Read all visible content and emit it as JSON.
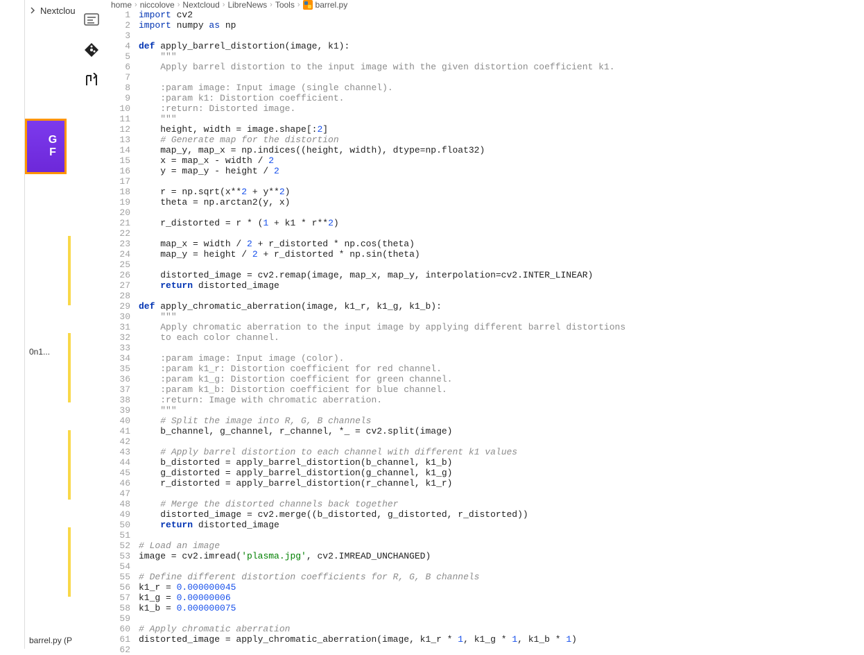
{
  "project": {
    "root_label": "Nextclou",
    "file_item": "0n1...",
    "thumb_line1": "G",
    "thumb_line2": "F"
  },
  "bottom_tab": "barrel.py (P",
  "breadcrumb": {
    "home": "home",
    "user": "niccolove",
    "cloud": "Nextcloud",
    "proj": "LibreNews",
    "dir": "Tools",
    "file": "barrel.py"
  },
  "code": {
    "total_lines": 62,
    "lines": [
      [
        [
          "imp",
          "import"
        ],
        [
          "",
          " cv2"
        ]
      ],
      [
        [
          "imp",
          "import"
        ],
        [
          "",
          " numpy "
        ],
        [
          "imp",
          "as"
        ],
        [
          "",
          " np"
        ]
      ],
      [
        [
          "",
          ""
        ]
      ],
      [
        [
          "kw",
          "def"
        ],
        [
          "",
          " apply_barrel_distortion(image, k1):"
        ]
      ],
      [
        [
          "",
          "    "
        ],
        [
          "doc",
          "\"\"\""
        ]
      ],
      [
        [
          "",
          "    "
        ],
        [
          "doc",
          "Apply barrel distortion to the input image with the given distortion coefficient k1."
        ]
      ],
      [
        [
          "",
          ""
        ]
      ],
      [
        [
          "",
          "    "
        ],
        [
          "doc",
          ":param image: Input image (single channel)."
        ]
      ],
      [
        [
          "",
          "    "
        ],
        [
          "doc",
          ":param k1: Distortion coefficient."
        ]
      ],
      [
        [
          "",
          "    "
        ],
        [
          "doc",
          ":return: Distorted image."
        ]
      ],
      [
        [
          "",
          "    "
        ],
        [
          "doc",
          "\"\"\""
        ]
      ],
      [
        [
          "",
          "    height, width = image.shape[:"
        ],
        [
          "num",
          "2"
        ],
        [
          "",
          "]"
        ]
      ],
      [
        [
          "",
          "    "
        ],
        [
          "cmt",
          "# Generate map for the distortion"
        ]
      ],
      [
        [
          "",
          "    map_y, map_x = np.indices((height, width), dtype=np.float32)"
        ]
      ],
      [
        [
          "",
          "    x = map_x - width / "
        ],
        [
          "num",
          "2"
        ]
      ],
      [
        [
          "",
          "    y = map_y - height / "
        ],
        [
          "num",
          "2"
        ]
      ],
      [
        [
          "",
          ""
        ]
      ],
      [
        [
          "",
          "    r = np.sqrt(x**"
        ],
        [
          "num",
          "2"
        ],
        [
          "",
          " + y**"
        ],
        [
          "num",
          "2"
        ],
        [
          "",
          ")"
        ]
      ],
      [
        [
          "",
          "    theta = np.arctan2(y, x)"
        ]
      ],
      [
        [
          "",
          ""
        ]
      ],
      [
        [
          "",
          "    r_distorted = r * ("
        ],
        [
          "num",
          "1"
        ],
        [
          "",
          " + k1 * r**"
        ],
        [
          "num",
          "2"
        ],
        [
          "",
          ")"
        ]
      ],
      [
        [
          "",
          ""
        ]
      ],
      [
        [
          "",
          "    map_x = width / "
        ],
        [
          "num",
          "2"
        ],
        [
          "",
          " + r_distorted * np.cos(theta)"
        ]
      ],
      [
        [
          "",
          "    map_y = height / "
        ],
        [
          "num",
          "2"
        ],
        [
          "",
          " + r_distorted * np.sin(theta)"
        ]
      ],
      [
        [
          "",
          ""
        ]
      ],
      [
        [
          "",
          "    distorted_image = cv2.remap(image, map_x, map_y, interpolation=cv2.INTER_LINEAR)"
        ]
      ],
      [
        [
          "",
          "    "
        ],
        [
          "kw",
          "return"
        ],
        [
          "",
          " distorted_image"
        ]
      ],
      [
        [
          "",
          ""
        ]
      ],
      [
        [
          "kw",
          "def"
        ],
        [
          "",
          " apply_chromatic_aberration(image, k1_r, k1_g, k1_b):"
        ]
      ],
      [
        [
          "",
          "    "
        ],
        [
          "doc",
          "\"\"\""
        ]
      ],
      [
        [
          "",
          "    "
        ],
        [
          "doc",
          "Apply chromatic aberration to the input image by applying different barrel distortions"
        ]
      ],
      [
        [
          "",
          "    "
        ],
        [
          "doc",
          "to each color channel."
        ]
      ],
      [
        [
          "",
          ""
        ]
      ],
      [
        [
          "",
          "    "
        ],
        [
          "doc",
          ":param image: Input image (color)."
        ]
      ],
      [
        [
          "",
          "    "
        ],
        [
          "doc",
          ":param k1_r: Distortion coefficient for red channel."
        ]
      ],
      [
        [
          "",
          "    "
        ],
        [
          "doc",
          ":param k1_g: Distortion coefficient for green channel."
        ]
      ],
      [
        [
          "",
          "    "
        ],
        [
          "doc",
          ":param k1_b: Distortion coefficient for blue channel."
        ]
      ],
      [
        [
          "",
          "    "
        ],
        [
          "doc",
          ":return: Image with chromatic aberration."
        ]
      ],
      [
        [
          "",
          "    "
        ],
        [
          "doc",
          "\"\"\""
        ]
      ],
      [
        [
          "",
          "    "
        ],
        [
          "cmt",
          "# Split the image into R, G, B channels"
        ]
      ],
      [
        [
          "",
          "    b_channel, g_channel, r_channel, *_ = cv2.split(image)"
        ]
      ],
      [
        [
          "",
          ""
        ]
      ],
      [
        [
          "",
          "    "
        ],
        [
          "cmt",
          "# Apply barrel distortion to each channel with different k1 values"
        ]
      ],
      [
        [
          "",
          "    b_distorted = apply_barrel_distortion(b_channel, k1_b)"
        ]
      ],
      [
        [
          "",
          "    g_distorted = apply_barrel_distortion(g_channel, k1_g)"
        ]
      ],
      [
        [
          "",
          "    r_distorted = apply_barrel_distortion(r_channel, k1_r)"
        ]
      ],
      [
        [
          "",
          ""
        ]
      ],
      [
        [
          "",
          "    "
        ],
        [
          "cmt",
          "# Merge the distorted channels back together"
        ]
      ],
      [
        [
          "",
          "    distorted_image = cv2.merge((b_distorted, g_distorted, r_distorted))"
        ]
      ],
      [
        [
          "",
          "    "
        ],
        [
          "kw",
          "return"
        ],
        [
          "",
          " distorted_image"
        ]
      ],
      [
        [
          "",
          ""
        ]
      ],
      [
        [
          "cmt",
          "# Load an image"
        ]
      ],
      [
        [
          "",
          "image = cv2.imread("
        ],
        [
          "str",
          "'plasma.jpg'"
        ],
        [
          "",
          ", cv2.IMREAD_UNCHANGED)"
        ]
      ],
      [
        [
          "",
          ""
        ]
      ],
      [
        [
          "cmt",
          "# Define different distortion coefficients for R, G, B channels"
        ]
      ],
      [
        [
          "",
          "k1_r = "
        ],
        [
          "num",
          "0.000000045"
        ]
      ],
      [
        [
          "",
          "k1_g = "
        ],
        [
          "num",
          "0.00000006"
        ]
      ],
      [
        [
          "",
          "k1_b = "
        ],
        [
          "num",
          "0.000000075"
        ]
      ],
      [
        [
          "",
          ""
        ]
      ],
      [
        [
          "cmt",
          "# Apply chromatic aberration"
        ]
      ],
      [
        [
          "",
          "distorted_image = apply_chromatic_aberration(image, k1_r * "
        ],
        [
          "num",
          "1"
        ],
        [
          "",
          ", k1_g * "
        ],
        [
          "num",
          "1"
        ],
        [
          "",
          ", k1_b * "
        ],
        [
          "num",
          "1"
        ],
        [
          "",
          ")"
        ]
      ]
    ]
  }
}
